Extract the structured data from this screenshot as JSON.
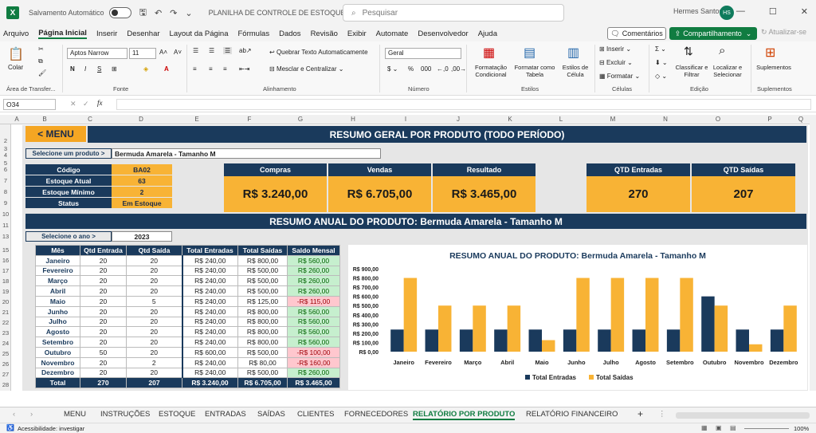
{
  "titlebar": {
    "autosave": "Salvamento Automático",
    "filename": "PLANILHA DE CONTROLE DE ESTOQUE.xlsx",
    "search_placeholder": "Pesquisar",
    "user": "Hermes Santos",
    "avatar": "HS"
  },
  "menu": [
    "Arquivo",
    "Página Inicial",
    "Inserir",
    "Desenhar",
    "Layout da Página",
    "Fórmulas",
    "Dados",
    "Revisão",
    "Exibir",
    "Automate",
    "Desenvolvedor",
    "Ajuda"
  ],
  "menu_active": "Página Inicial",
  "buttons": {
    "comments": "Comentários",
    "share": "Compartilhamento",
    "update": "Atualizar-se"
  },
  "ribbon": {
    "paste": "Colar",
    "clipboard": "Área de Transfer...",
    "font_name": "Aptos Narrow",
    "font_size": "11",
    "font_group": "Fonte",
    "wrap": "Quebrar Texto Automaticamente",
    "merge": "Mesclar e Centralizar",
    "align_group": "Alinhamento",
    "number_format": "Geral",
    "number_group": "Número",
    "cond_format": "Formatação Condicional",
    "format_table": "Formatar como Tabela",
    "cell_styles": "Estilos de Célula",
    "styles_group": "Estilos",
    "insert": "Inserir",
    "delete": "Excluir",
    "format": "Formatar",
    "cells_group": "Células",
    "sort": "Classificar e Filtrar",
    "find": "Localizar e Selecionar",
    "edit_group": "Edição",
    "addins": "Suplementos",
    "addins_group": "Suplementos"
  },
  "formula_bar": {
    "name_box": "O34",
    "formula": ""
  },
  "columns": [
    "A",
    "B",
    "C",
    "D",
    "E",
    "F",
    "G",
    "H",
    "I",
    "J",
    "K",
    "L",
    "M",
    "N",
    "O",
    "P",
    "Q"
  ],
  "rows": [
    "2",
    "3",
    "4",
    "5",
    "6",
    "7",
    "8",
    "9",
    "10",
    "11",
    "13",
    "15",
    "16",
    "17",
    "18",
    "19",
    "20",
    "21",
    "22",
    "23",
    "24",
    "25",
    "26",
    "27",
    "28",
    "29",
    "30"
  ],
  "dashboard": {
    "menu_button": "< MENU",
    "title": "RESUMO GERAL POR PRODUTO (TODO PERÍODO)",
    "select_label": "Selecione um produto >",
    "product": "Bermuda Amarela - Tamanho M",
    "info": [
      {
        "label": "Código",
        "value": "BA02"
      },
      {
        "label": "Estoque Atual",
        "value": "63"
      },
      {
        "label": "Estoque Mínimo",
        "value": "2"
      },
      {
        "label": "Status",
        "value": "Em Estoque"
      }
    ],
    "kpis": [
      {
        "label": "Compras",
        "value": "R$ 3.240,00"
      },
      {
        "label": "Vendas",
        "value": "R$ 6.705,00"
      },
      {
        "label": "Resultado",
        "value": "R$ 3.465,00"
      },
      {
        "label": "QTD Entradas",
        "value": "270"
      },
      {
        "label": "QTD Saídas",
        "value": "207"
      }
    ],
    "annual_title": "RESUMO ANUAL DO PRODUTO: Bermuda Amarela - Tamanho M",
    "year_label": "Selecione o ano >",
    "year": "2023",
    "table_headers": [
      "Mês",
      "Qtd Entrada",
      "Qtd Saída",
      "Total Entradas",
      "Total Saídas",
      "Saldo Mensal"
    ],
    "table_rows": [
      [
        "Janeiro",
        "20",
        "20",
        "R$ 240,00",
        "R$ 800,00",
        "R$ 560,00"
      ],
      [
        "Fevereiro",
        "20",
        "20",
        "R$ 240,00",
        "R$ 500,00",
        "R$ 260,00"
      ],
      [
        "Março",
        "20",
        "20",
        "R$ 240,00",
        "R$ 500,00",
        "R$ 260,00"
      ],
      [
        "Abril",
        "20",
        "20",
        "R$ 240,00",
        "R$ 500,00",
        "R$ 260,00"
      ],
      [
        "Maio",
        "20",
        "5",
        "R$ 240,00",
        "R$ 125,00",
        "-R$ 115,00"
      ],
      [
        "Junho",
        "20",
        "20",
        "R$ 240,00",
        "R$ 800,00",
        "R$ 560,00"
      ],
      [
        "Julho",
        "20",
        "20",
        "R$ 240,00",
        "R$ 800,00",
        "R$ 560,00"
      ],
      [
        "Agosto",
        "20",
        "20",
        "R$ 240,00",
        "R$ 800,00",
        "R$ 560,00"
      ],
      [
        "Setembro",
        "20",
        "20",
        "R$ 240,00",
        "R$ 800,00",
        "R$ 560,00"
      ],
      [
        "Outubro",
        "50",
        "20",
        "R$ 600,00",
        "R$ 500,00",
        "-R$ 100,00"
      ],
      [
        "Novembro",
        "20",
        "2",
        "R$ 240,00",
        "R$ 80,00",
        "-R$ 160,00"
      ],
      [
        "Dezembro",
        "20",
        "20",
        "R$ 240,00",
        "R$ 500,00",
        "R$ 260,00"
      ]
    ],
    "table_total": [
      "Total",
      "270",
      "207",
      "R$ 3.240,00",
      "R$ 6.705,00",
      "R$ 3.465,00"
    ]
  },
  "chart_data": {
    "type": "bar",
    "title": "RESUMO ANUAL DO PRODUTO: Bermuda Amarela - Tamanho M",
    "categories": [
      "Janeiro",
      "Fevereiro",
      "Março",
      "Abril",
      "Maio",
      "Junho",
      "Julho",
      "Agosto",
      "Setembro",
      "Outubro",
      "Novembro",
      "Dezembro"
    ],
    "series": [
      {
        "name": "Total Entradas",
        "color": "#1a3a5c",
        "values": [
          240,
          240,
          240,
          240,
          240,
          240,
          240,
          240,
          240,
          600,
          240,
          240
        ]
      },
      {
        "name": "Total Saídas",
        "color": "#f8b335",
        "values": [
          800,
          500,
          500,
          500,
          125,
          800,
          800,
          800,
          800,
          500,
          80,
          500
        ]
      }
    ],
    "ylim": [
      0,
      900
    ],
    "yticks": [
      "R$ 0,00",
      "R$ 100,00",
      "R$ 200,00",
      "R$ 300,00",
      "R$ 400,00",
      "R$ 500,00",
      "R$ 600,00",
      "R$ 700,00",
      "R$ 800,00",
      "R$ 900,00"
    ],
    "legend": "bottom",
    "grid": false
  },
  "tabs": [
    "MENU",
    "INSTRUÇÕES",
    "ESTOQUE",
    "ENTRADAS",
    "SAÍDAS",
    "CLIENTES",
    "FORNECEDORES",
    "RELATÓRIO POR PRODUTO",
    "RELATÓRIO FINANCEIRO"
  ],
  "active_tab": "RELATÓRIO POR PRODUTO",
  "status": {
    "accessibility": "Acessibilidade: investigar",
    "zoom": "100%"
  }
}
